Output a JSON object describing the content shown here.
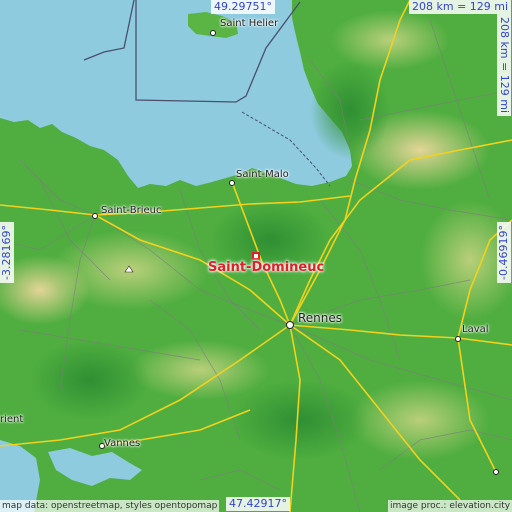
{
  "map": {
    "colors": {
      "sea": "#8ecbdf",
      "land_low": "#3fa33a",
      "land_mid": "#6fbf4a",
      "land_high": "#d8cf8c",
      "road_major": "#f2d21d",
      "road_minor": "#8a8a8a",
      "border": "#4a4f6a",
      "target": "#e0202b",
      "coord_text": "#3344cc"
    },
    "target_place": "Saint-Domineuc",
    "cities": [
      {
        "name": "Saint Helier",
        "icon": "city-dot-icon"
      },
      {
        "name": "Saint-Malo",
        "icon": "city-dot-icon"
      },
      {
        "name": "Saint-Brieuc",
        "icon": "city-dot-icon"
      },
      {
        "name": "Rennes",
        "icon": "city-dot-icon"
      },
      {
        "name": "Laval",
        "icon": "city-dot-icon"
      },
      {
        "name": "Vannes",
        "icon": "city-dot-icon"
      },
      {
        "name": "rient",
        "icon": "city-dot-icon"
      }
    ],
    "coords": {
      "north": "49.29751°",
      "south": "47.42917°",
      "west": "-3.28169°",
      "east": "-0.46919°"
    },
    "scale": {
      "horizontal": "208 km = 129 mi",
      "vertical": "208 km = 129 mi"
    },
    "credits": {
      "left": "map data: openstreetmap, styles opentopomap",
      "right": "image proc.: elevation.city"
    }
  }
}
